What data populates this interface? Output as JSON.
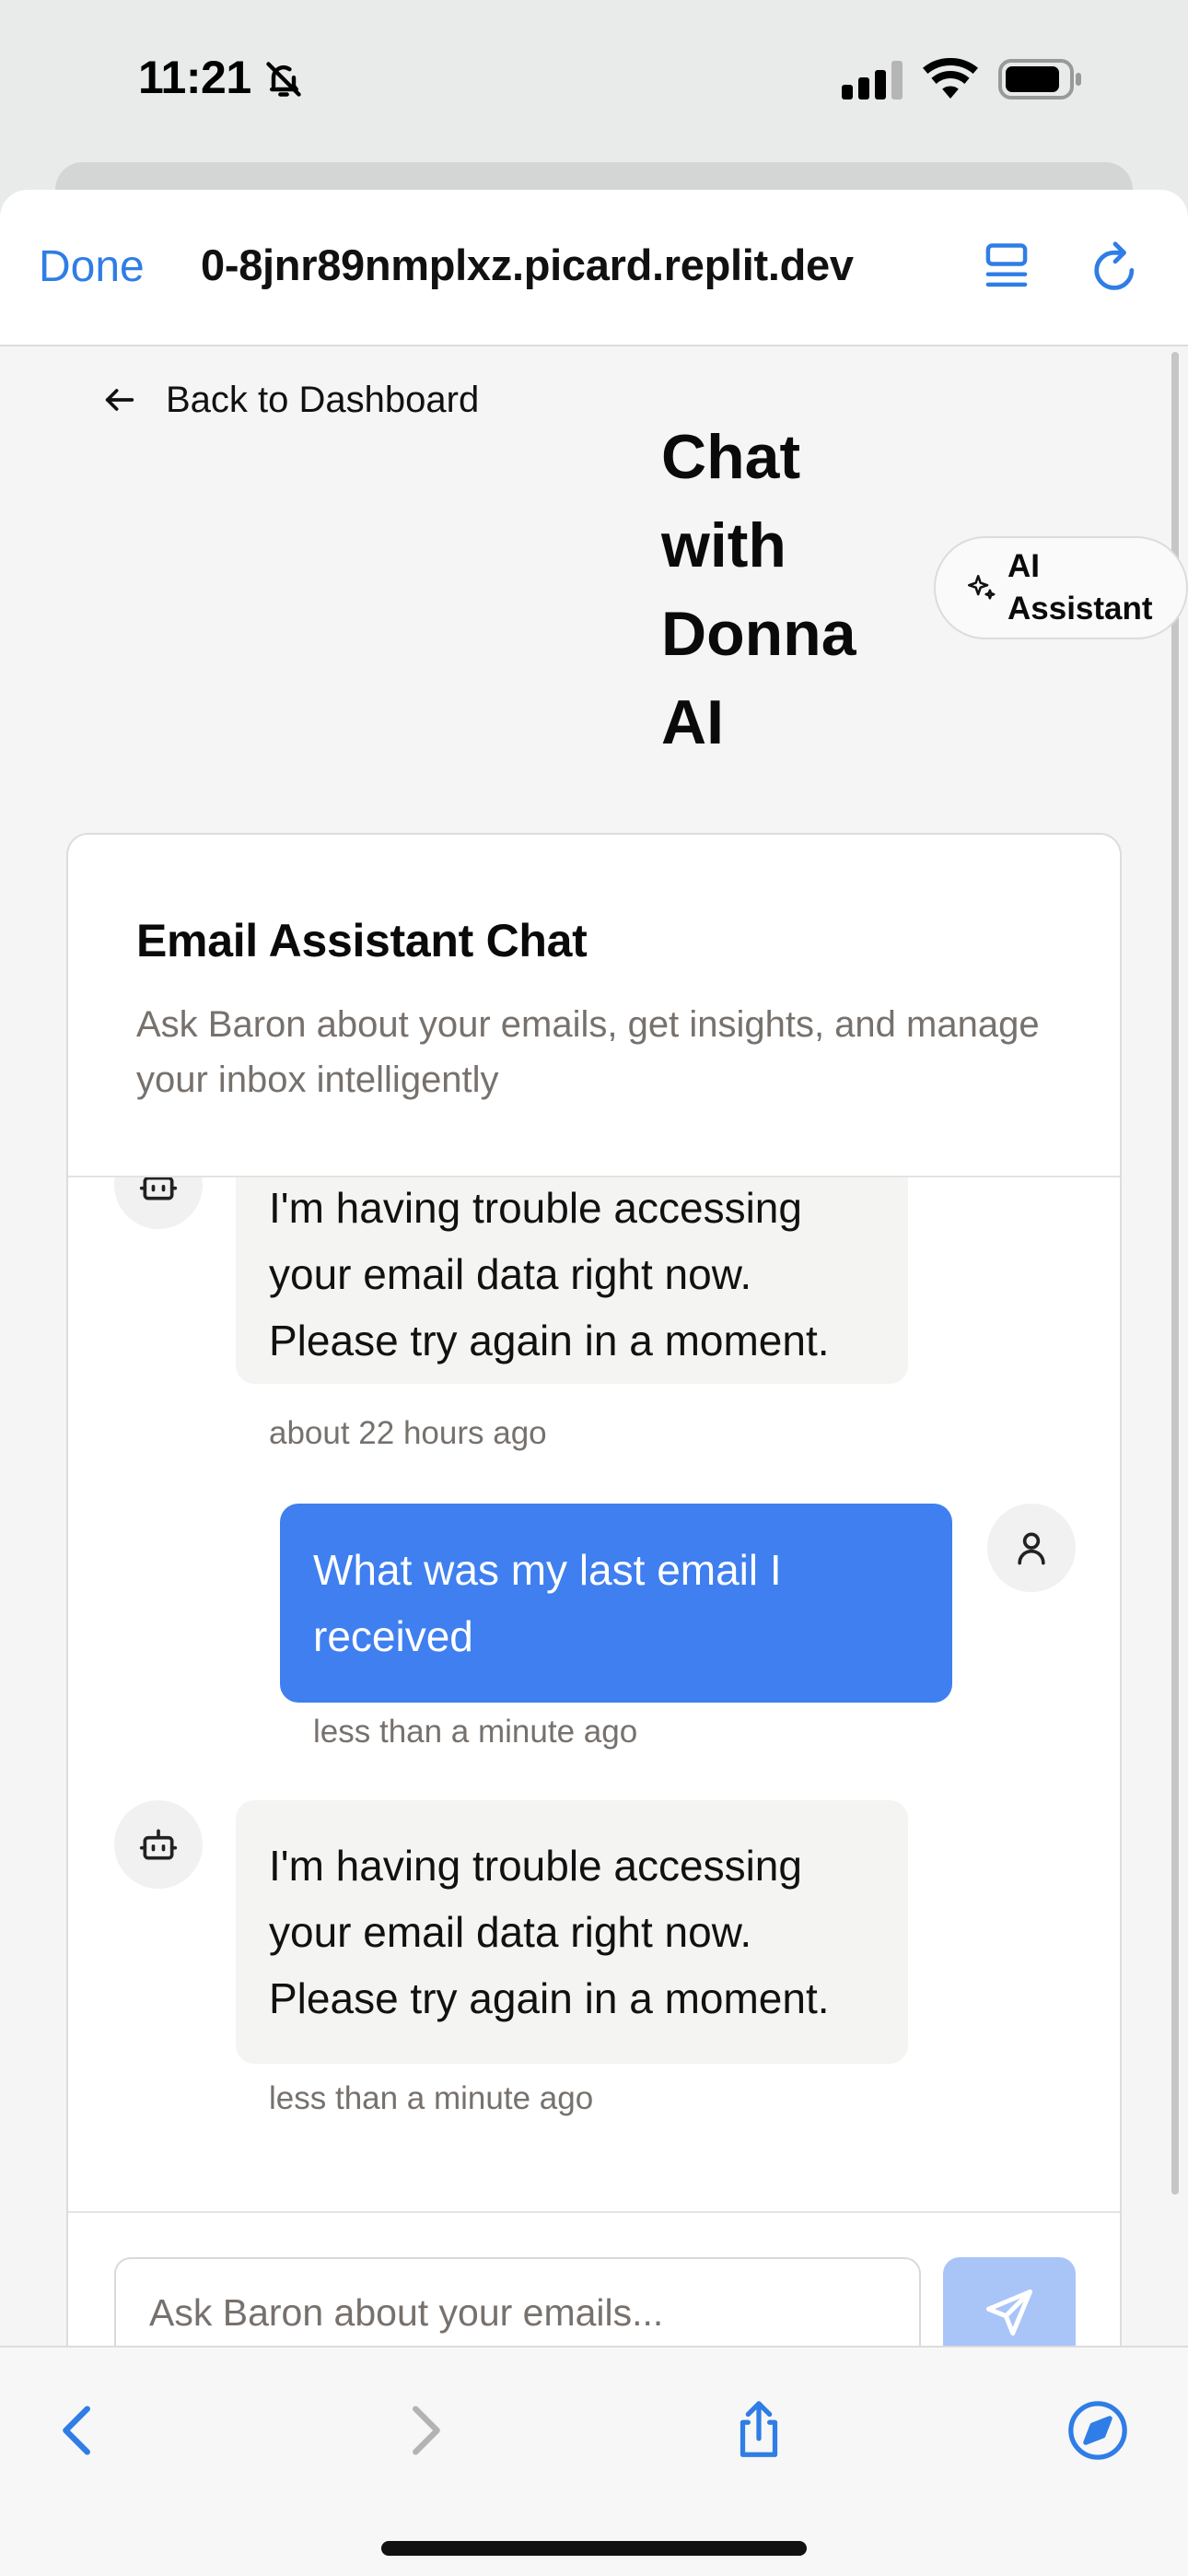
{
  "status_bar": {
    "time": "11:21"
  },
  "browser": {
    "done_label": "Done",
    "url": "0-8jnr89nmplxz.picard.replit.dev"
  },
  "header": {
    "back_label": "Back to Dashboard",
    "title": "Chat with Donna AI",
    "badge_label": "AI Assistant"
  },
  "chat": {
    "title": "Email Assistant Chat",
    "description": "Ask Baron about your emails, get insights, and manage your inbox intelligently",
    "messages": [
      {
        "role": "assistant",
        "text": "I'm having trouble accessing your email data right now. Please try again in a moment.",
        "time": "about 22 hours ago"
      },
      {
        "role": "user",
        "text": "What was my last email I received",
        "time": "less than a minute ago"
      },
      {
        "role": "assistant",
        "text": "I'm having trouble accessing your email data right now. Please try again in a moment.",
        "time": "less than a minute ago"
      }
    ],
    "input_placeholder": "Ask Baron about your emails..."
  },
  "colors": {
    "accent": "#2f7de6",
    "user_bubble": "#3f7ff0",
    "bot_bubble": "#f4f4f3",
    "send_button": "#a9c4f7",
    "muted_text": "#77716d"
  },
  "icons": {
    "status": [
      "bell-slash-icon",
      "cellular-signal-icon",
      "wifi-icon",
      "battery-icon"
    ],
    "browser": [
      "reader-mode-icon",
      "reload-icon"
    ],
    "header": [
      "arrow-left-icon",
      "sparkles-icon"
    ],
    "avatars": [
      "bot-icon",
      "user-icon"
    ],
    "input": [
      "send-icon"
    ],
    "toolbar": [
      "back-chevron-icon",
      "forward-chevron-icon",
      "share-icon",
      "compass-icon"
    ]
  }
}
